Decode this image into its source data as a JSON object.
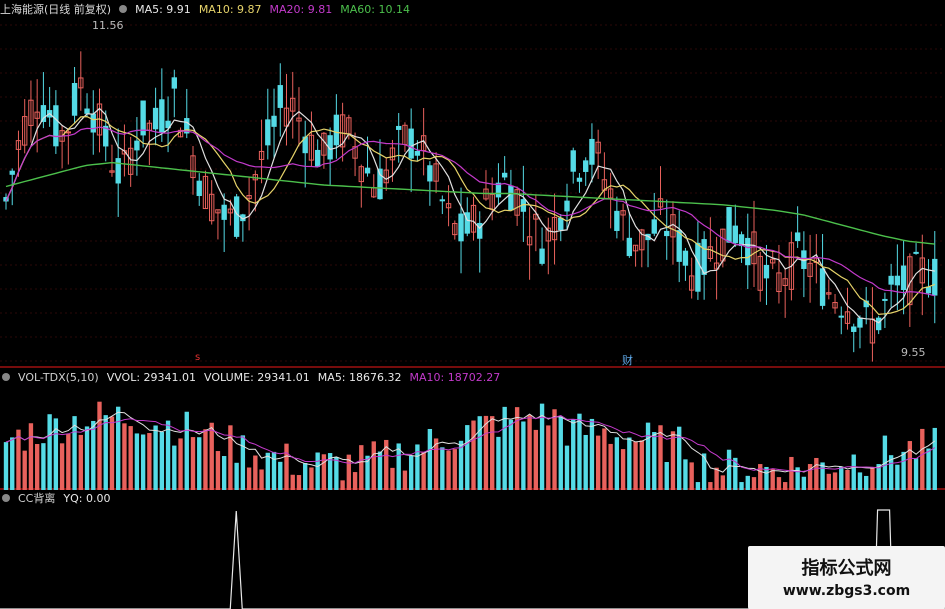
{
  "colors": {
    "up": "#e8615c",
    "down": "#55dbe6",
    "ma5": "#e0e0e0",
    "ma10": "#e6d36a",
    "ma20": "#c33acb",
    "ma60": "#4cc04c",
    "divider": "#a01010",
    "grid": "#5a1010"
  },
  "price_header": {
    "title": "上海能源(日线 前复权)",
    "ma5": "MA5: 9.91",
    "ma10": "MA10: 9.87",
    "ma20": "MA20: 9.81",
    "ma60": "MA60: 10.14"
  },
  "vol_header": {
    "title": "VOL-TDX(5,10)",
    "vvol": "VVOL: 29341.01",
    "volume": "VOLUME: 29341.01",
    "ma5": "MA5: 18676.32",
    "ma10": "MA10: 18702.27"
  },
  "ind_header": {
    "title": "CC背离",
    "yq": "YQ: 0.00"
  },
  "labels": {
    "high": "11.56",
    "low": "9.55",
    "cai": "财",
    "s": "s"
  },
  "watermark": {
    "line1": "指标公式网",
    "line2": "www.zbgs3.com"
  },
  "chart_data": {
    "type": "candlestick",
    "price_range": [
      9.3,
      11.75
    ],
    "high_marker": 11.56,
    "low_marker": 9.55,
    "ma_last": {
      "MA5": 9.91,
      "MA10": 9.87,
      "MA20": 9.81,
      "MA60": 10.14
    },
    "close_path": [
      10.45,
      10.8,
      11.05,
      11.2,
      11.1,
      10.9,
      11.0,
      11.3,
      11.15,
      10.95,
      10.75,
      10.6,
      10.85,
      11.0,
      10.95,
      11.1,
      11.2,
      10.95,
      10.7,
      10.5,
      10.4,
      10.3,
      10.35,
      10.5,
      10.7,
      10.9,
      11.1,
      11.15,
      11.0,
      10.85,
      10.75,
      10.9,
      10.95,
      10.85,
      10.7,
      10.55,
      10.65,
      10.8,
      10.9,
      10.85,
      10.7,
      10.5,
      10.3,
      10.2,
      10.25,
      10.35,
      10.5,
      10.6,
      10.55,
      10.4,
      10.25,
      10.15,
      10.3,
      10.5,
      10.7,
      10.8,
      10.75,
      10.55,
      10.35,
      10.2,
      10.15,
      10.2,
      10.3,
      10.25,
      10.1,
      9.95,
      10.0,
      10.1,
      10.2,
      10.25,
      10.2,
      10.05,
      9.9,
      9.85,
      9.95,
      10.05,
      10.0,
      9.9,
      9.8,
      9.75,
      9.7,
      9.6,
      9.55,
      9.65,
      9.8,
      9.85,
      9.9,
      9.95,
      9.91
    ],
    "ma60_path": [
      10.55,
      10.6,
      10.65,
      10.7,
      10.72,
      10.7,
      10.68,
      10.66,
      10.64,
      10.62,
      10.6,
      10.58,
      10.56,
      10.55,
      10.54,
      10.53,
      10.52,
      10.51,
      10.5,
      10.5,
      10.49,
      10.48,
      10.47,
      10.46,
      10.45,
      10.44,
      10.43,
      10.42,
      10.4,
      10.38,
      10.35,
      10.3,
      10.25,
      10.2,
      10.16,
      10.14
    ],
    "volume_range": [
      0,
      80000
    ],
    "volume_ma5_last": 18676.32,
    "volume_ma10_last": 18702.27,
    "volume_last": 29341.01,
    "yq_last": 0.0,
    "yq_spikes_at": [
      0.25,
      0.935
    ]
  }
}
